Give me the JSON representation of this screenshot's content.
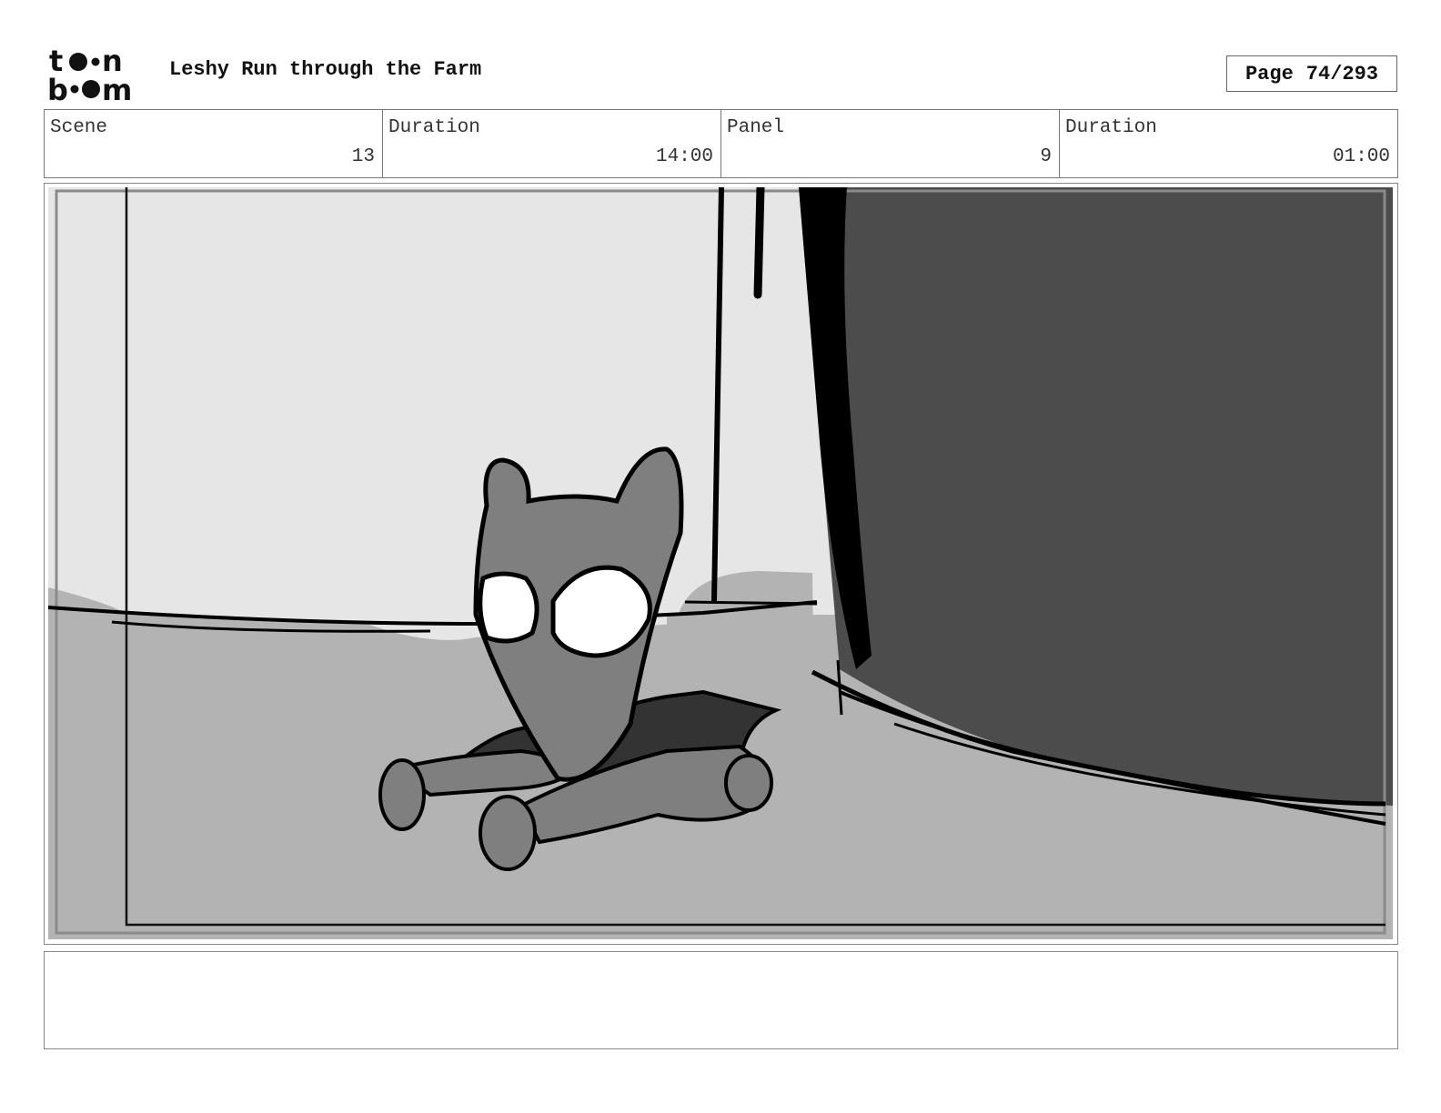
{
  "header": {
    "logo_text": "toon boom",
    "title": "Leshy Run through the Farm",
    "page_label": "Page",
    "page_number": "74/293"
  },
  "info": {
    "scene_label": "Scene",
    "scene_value": "13",
    "scene_duration_label": "Duration",
    "scene_duration_value": "14:00",
    "panel_label": "Panel",
    "panel_value": "9",
    "panel_duration_label": "Duration",
    "panel_duration_value": "01:00"
  },
  "panel": {
    "colors": {
      "wall": "#e6e6e6",
      "floor": "#b3b3b3",
      "dark_panel": "#4c4c4c",
      "character": "#7f7f7f",
      "cape": "#333333",
      "outline": "#000000"
    }
  },
  "notes": {
    "text": ""
  }
}
